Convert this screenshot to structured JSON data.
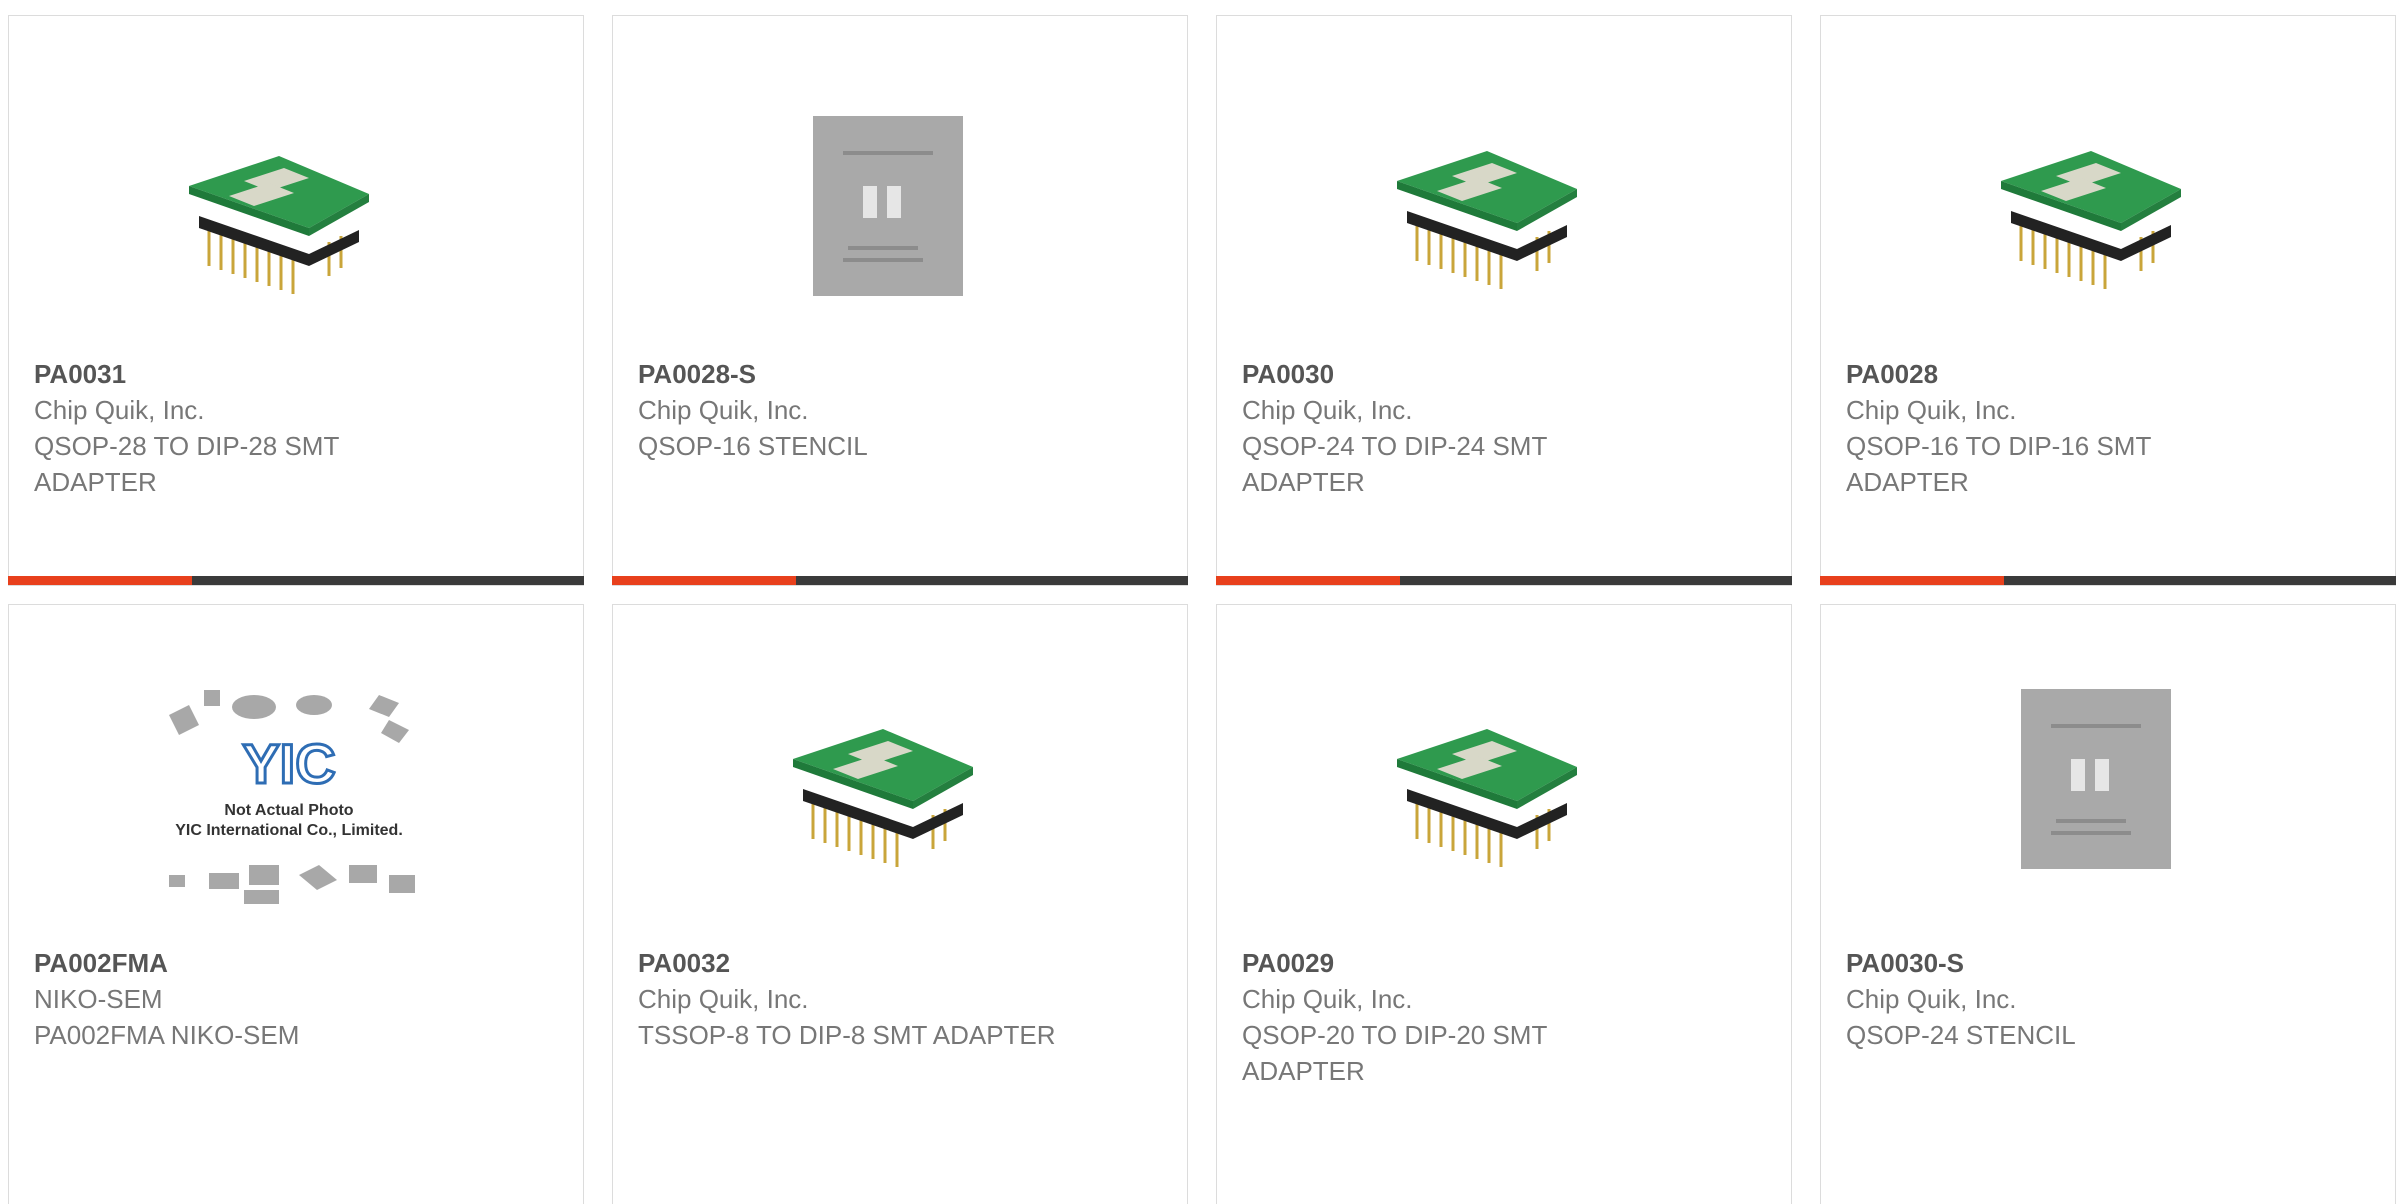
{
  "products": [
    {
      "part": "PA0031",
      "manufacturer": "Chip Quik, Inc.",
      "description": "QSOP-28 TO DIP-28 SMT ADAPTER",
      "image": "dip-adapter-28-icon"
    },
    {
      "part": "PA0028-S",
      "manufacturer": "Chip Quik, Inc.",
      "description": "QSOP-16 STENCIL",
      "image": "stencil-icon"
    },
    {
      "part": "PA0030",
      "manufacturer": "Chip Quik, Inc.",
      "description": "QSOP-24 TO DIP-24 SMT ADAPTER",
      "image": "dip-adapter-24-icon"
    },
    {
      "part": "PA0028",
      "manufacturer": "Chip Quik, Inc.",
      "description": "QSOP-16 TO DIP-16 SMT ADAPTER",
      "image": "dip-adapter-16-icon"
    },
    {
      "part": "PA002FMA",
      "manufacturer": "NIKO-SEM",
      "description": "PA002FMA NIKO-SEM",
      "image": "placeholder-photo-icon",
      "placeholder": {
        "logo": "YIC",
        "line1": "Not Actual Photo",
        "line2": "YIC International Co., Limited."
      }
    },
    {
      "part": "PA0032",
      "manufacturer": "Chip Quik, Inc.",
      "description": "TSSOP-8 TO DIP-8 SMT ADAPTER",
      "image": "dip-adapter-8-icon"
    },
    {
      "part": "PA0029",
      "manufacturer": "Chip Quik, Inc.",
      "description": "QSOP-20 TO DIP-20 SMT ADAPTER",
      "image": "dip-adapter-20-icon"
    },
    {
      "part": "PA0030-S",
      "manufacturer": "Chip Quik, Inc.",
      "description": "QSOP-24 STENCIL",
      "image": "stencil-icon"
    }
  ],
  "colors": {
    "accent": "#e8401c",
    "bar": "#3a3a3a",
    "pcb": "#2f9a4e",
    "stencil": "#a9a9a9"
  }
}
